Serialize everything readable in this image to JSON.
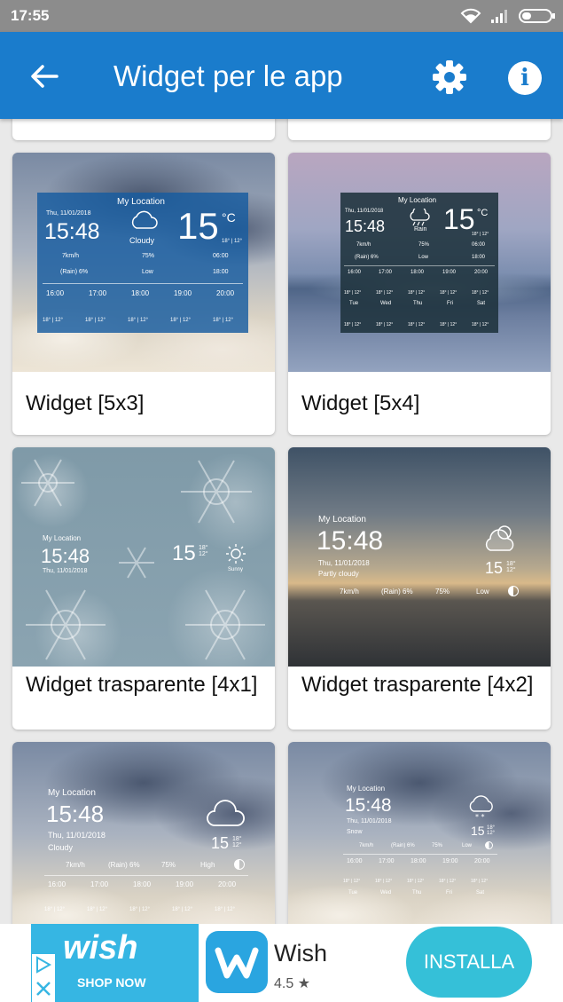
{
  "status_bar": {
    "time": "17:55"
  },
  "app_bar": {
    "title": "Widget per le app"
  },
  "cards": {
    "w5x3": {
      "label": "Widget [5x3]",
      "location": "My Location",
      "date": "Thu, 11/01/2018",
      "time": "15:48",
      "condition": "Cloudy",
      "temp": "15",
      "unit": "°C",
      "minmax": "18° | 12°",
      "wind": "7km/h",
      "humidity": "75%",
      "sunrise": "06:00",
      "rain": "(Rain) 6%",
      "uv": "Low",
      "sunset": "18:00",
      "hours": [
        "16:00",
        "17:00",
        "18:00",
        "19:00",
        "20:00"
      ],
      "hour_temps": [
        "18° | 12°",
        "18° | 12°",
        "18° | 12°",
        "18° | 12°",
        "18° | 12°"
      ]
    },
    "w5x4": {
      "label": "Widget [5x4]",
      "location": "My Location",
      "date": "Thu, 11/01/2018",
      "time": "15:48",
      "condition": "Rain",
      "temp": "15",
      "unit": "°C",
      "minmax": "18° | 12°",
      "wind": "7km/h",
      "humidity": "75%",
      "sunrise": "06:00",
      "rain": "(Rain) 6%",
      "uv": "Low",
      "sunset": "18:00",
      "hours": [
        "16:00",
        "17:00",
        "18:00",
        "19:00",
        "20:00"
      ],
      "days": [
        "Tue",
        "Wed",
        "Thu",
        "Fri",
        "Sat"
      ],
      "row_temps": [
        "18° | 12°",
        "18° | 12°",
        "18° | 12°",
        "18° | 12°",
        "18° | 12°"
      ]
    },
    "w4x1": {
      "label": "Widget trasparente [4x1]",
      "location": "My Location",
      "time": "15:48",
      "date": "Thu, 11/01/2018",
      "temp": "15",
      "minmax": "18° 12°",
      "condition": "Sunny"
    },
    "w4x2": {
      "label": "Widget trasparente [4x2]",
      "location": "My Location",
      "time": "15:48",
      "date": "Thu, 11/01/2018",
      "condition": "Partly cloudy",
      "temp": "15",
      "minmax": "18° 12°",
      "wind": "7km/h",
      "rain": "(Rain) 6%",
      "humidity": "75%",
      "uv": "Low"
    },
    "w5a": {
      "location": "My Location",
      "time": "15:48",
      "date": "Thu, 11/01/2018",
      "condition": "Cloudy",
      "temp": "15",
      "minmax": "18° 12°",
      "wind": "7km/h",
      "rain": "(Rain) 6%",
      "humidity": "75%",
      "uv": "High",
      "hours": [
        "16:00",
        "17:00",
        "18:00",
        "19:00",
        "20:00"
      ],
      "hour_temps": [
        "18° | 12°",
        "18° | 12°",
        "18° | 12°",
        "18° | 12°",
        "18° | 12°"
      ]
    },
    "w5b": {
      "location": "My Location",
      "time": "15:48",
      "date": "Thu, 11/01/2018",
      "condition": "Snow",
      "temp": "15",
      "minmax": "18° 12°",
      "wind": "7km/h",
      "rain": "(Rain) 6%",
      "humidity": "75%",
      "uv": "Low",
      "hours": [
        "16:00",
        "17:00",
        "18:00",
        "19:00",
        "20:00"
      ],
      "hour_temps": [
        "18° | 12°",
        "18° | 12°",
        "18° | 12°",
        "18° | 12°",
        "18° | 12°"
      ],
      "days": [
        "Tue",
        "Wed",
        "Thu",
        "Fri",
        "Sat"
      ]
    }
  },
  "ad": {
    "banner_brand": "wish",
    "banner_cta": "SHOP NOW",
    "app_name": "Wish",
    "rating": "4.5",
    "install_label": "INSTALLA"
  },
  "colors": {
    "app_bar": "#1a7ccc",
    "status_bar": "#8c8c8c",
    "install_button": "#35c0d8",
    "wish_blue": "#36b6e3"
  }
}
